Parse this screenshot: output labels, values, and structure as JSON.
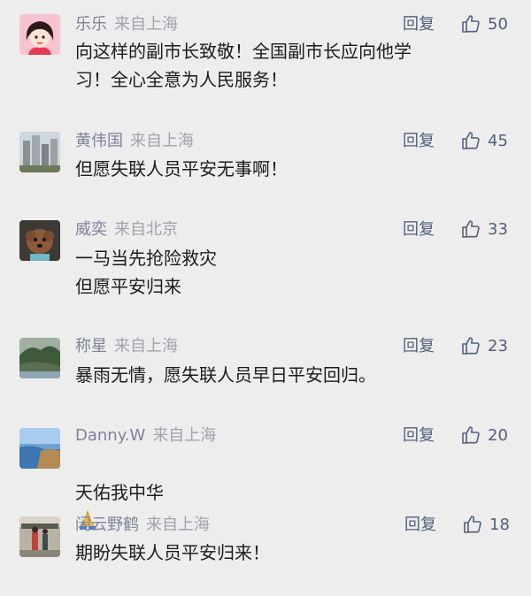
{
  "comments": [
    {
      "name": "乐乐",
      "location": "来自上海",
      "reply_label": "回复",
      "likes": "50",
      "text": "向这样的副市长致敬！全国副市长应向他学\n习！全心全意为人民服务！",
      "avatar": "cartoon-girl-avatar"
    },
    {
      "name": "黄伟国",
      "location": "来自上海",
      "reply_label": "回复",
      "likes": "45",
      "text": "但愿失联人员平安无事啊！",
      "avatar": "buildings-photo-avatar"
    },
    {
      "name": "威奕",
      "location": "来自北京",
      "reply_label": "回复",
      "likes": "33",
      "text": "一马当先抢险救灾\n但愿平安归来",
      "avatar": "dog-photo-avatar"
    },
    {
      "name": "称星",
      "location": "来自上海",
      "reply_label": "回复",
      "likes": "23",
      "text": "暴雨无情，愿失联人员早日平安回归。",
      "avatar": "landscape-photo-avatar"
    },
    {
      "name": "Danny.W",
      "location": "来自上海",
      "reply_label": "回复",
      "likes": "20",
      "text": "天佑我中华",
      "avatar": "coast-photo-avatar",
      "emoji": "praying-hands-icon"
    },
    {
      "name": "闲云野鹤",
      "location": "来自上海",
      "reply_label": "回复",
      "likes": "18",
      "text": "期盼失联人员平安归来！",
      "avatar": "people-photo-avatar"
    }
  ],
  "colors": {
    "background": "#ededed",
    "name": "#7e8497",
    "location": "#a0a3ad",
    "action": "#53607a",
    "text": "#1c1c1c"
  }
}
